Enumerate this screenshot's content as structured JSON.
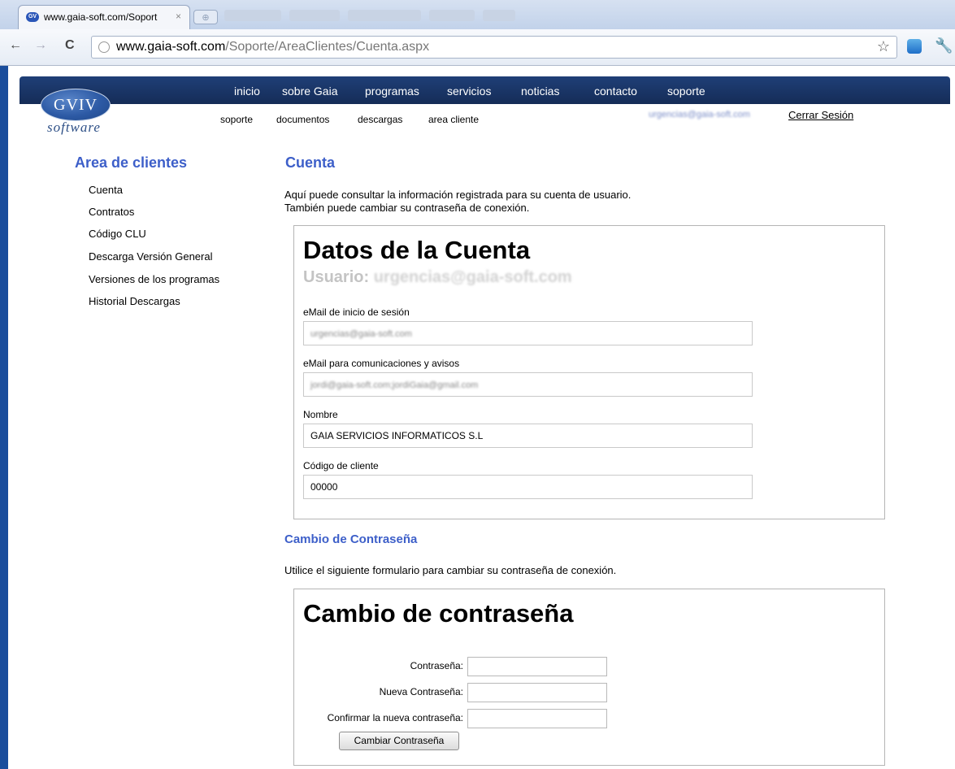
{
  "browser": {
    "tab_title": "www.gaia-soft.com/Soport",
    "tab_close": "×",
    "new_tab": "⊕",
    "url_domain": "www.gaia-soft.com",
    "url_path": "/Soporte/AreaClientes/Cuenta.aspx",
    "back": "←",
    "forward": "→",
    "reload": "C",
    "star": "☆",
    "wrench": "🔧"
  },
  "logo": {
    "mark": "GVIV",
    "word": "software"
  },
  "mainnav": [
    "inicio",
    "sobre Gaia",
    "programas",
    "servicios",
    "noticias",
    "contacto",
    "soporte"
  ],
  "subnav": [
    "soporte",
    "documentos",
    "descargas",
    "area cliente"
  ],
  "session": {
    "email": "urgencias@gaia-soft.com",
    "logout": "Cerrar Sesión"
  },
  "sidebar": {
    "title": "Area de clientes",
    "items": [
      "Cuenta",
      "Contratos",
      "Código CLU",
      "Descarga Versión General",
      "Versiones de los programas",
      "Historial Descargas"
    ]
  },
  "main": {
    "title": "Cuenta",
    "intro_line1": "Aquí puede consultar la información registrada para su cuenta de usuario.",
    "intro_line2": "También puede cambiar su contraseña de conexión."
  },
  "account": {
    "title": "Datos de la Cuenta",
    "user_label": "Usuario:",
    "user_value": "urgencias@gaia-soft.com",
    "fields": [
      {
        "label": "eMail de inicio de sesión",
        "value": "urgencias@gaia-soft.com"
      },
      {
        "label": "eMail para comunicaciones y avisos",
        "value": "jordi@gaia-soft.com;jordiGaia@gmail.com"
      },
      {
        "label": "Nombre",
        "value": "GAIA SERVICIOS INFORMATICOS S.L"
      },
      {
        "label": "Código de cliente",
        "value": "00000"
      }
    ]
  },
  "password_section": {
    "title": "Cambio de Contraseña",
    "intro": "Utilice el siguiente formulario para cambiar su contraseña de conexión.",
    "box_title": "Cambio de contraseña",
    "labels": [
      "Contraseña:",
      "Nueva Contraseña:",
      "Confirmar la nueva contraseña:"
    ],
    "button": "Cambiar Contraseña"
  }
}
